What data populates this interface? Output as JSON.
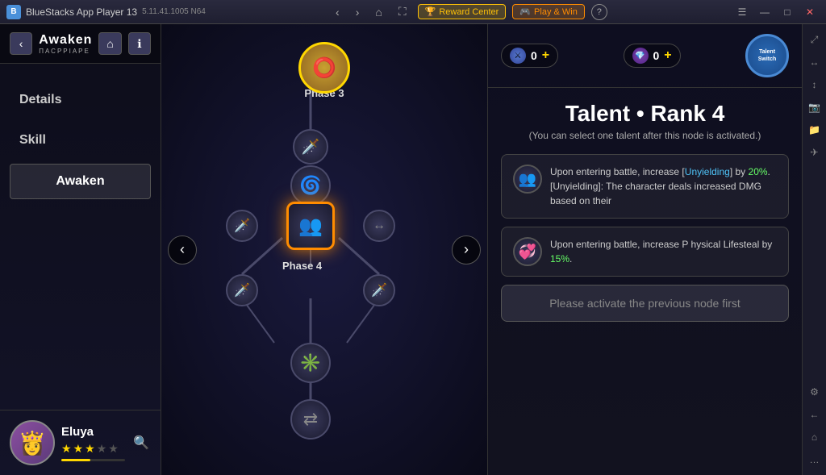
{
  "titlebar": {
    "app_name": "BlueStacks App Player 13",
    "version": "5.11.41.1005  N64",
    "logo_text": "B",
    "reward_center": "Reward Center",
    "play_win": "Play & Win",
    "help_icon": "?",
    "nav_back": "‹",
    "nav_home": "⌂",
    "nav_minimize": "—",
    "nav_maximize": "□",
    "nav_close": "✕",
    "nav_menu": "☰"
  },
  "sidebar": {
    "back_label": "‹",
    "title": "Awaken",
    "subtitle": "ПАСРΡΙΑΡΕ",
    "home_icon": "⌂",
    "info_icon": "ℹ",
    "nav_items": [
      {
        "label": "Details",
        "active": false
      },
      {
        "label": "Skill",
        "active": false
      },
      {
        "label": "Awaken",
        "active": true
      }
    ],
    "left_arrow": "‹"
  },
  "character": {
    "name": "Eluya",
    "stars_filled": 3,
    "stars_empty": 2,
    "avatar_icon": "👸",
    "search_icon": "🔍"
  },
  "game": {
    "phase3_label": "Phase 3",
    "phase4_label": "Phase 4",
    "left_arrow": "‹",
    "right_arrow": "›"
  },
  "right_panel": {
    "currency1_value": "0",
    "currency1_plus": "+",
    "currency2_value": "0",
    "currency2_plus": "+",
    "talent_switch_label": "Talent\nSwitch",
    "talent_title": "Talent • Rank 4",
    "talent_desc": "(You can select one talent after this node is activated.)",
    "option1_text_part1": "Upon entering battle, increase [",
    "option1_highlight": "Unyielding",
    "option1_text_part2": "] by ",
    "option1_percent": "20%",
    "option1_text_part3": ".",
    "option1_sub": "[Unyielding]: The character deals increased DMG based on their",
    "option2_text_part1": "Upon entering battle, increase P hysical Lifesteal by ",
    "option2_percent": "15%",
    "option2_text_part2": ".",
    "activate_btn_label": "Please activate the previous node first",
    "talent_switch_line1": "Talent",
    "talent_switch_line2": "Switch"
  },
  "edge_toolbar": {
    "icons": [
      "⤢",
      "↔",
      "↕",
      "📷",
      "📁",
      "✈",
      "⚙",
      "←",
      "⌂",
      "…"
    ]
  }
}
